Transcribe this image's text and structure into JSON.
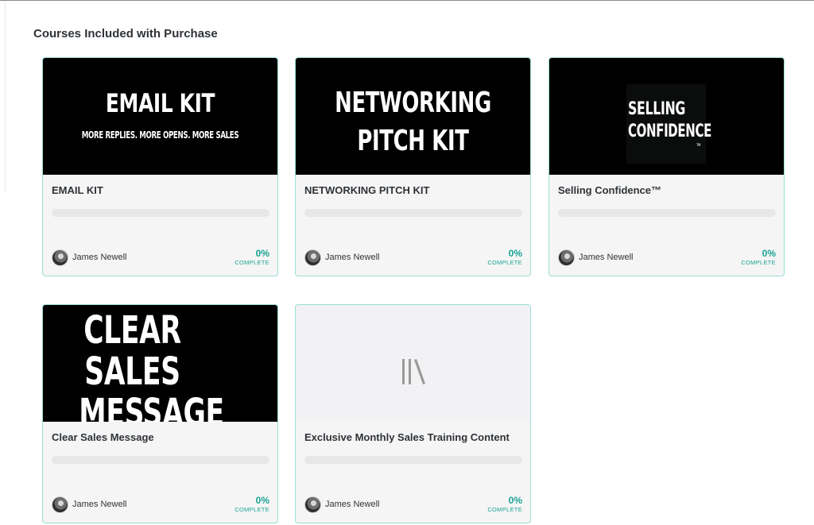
{
  "section": {
    "title": "Courses Included with Purchase"
  },
  "courses": [
    {
      "title": "EMAIL KIT",
      "thumb_lines": [
        "EMAIL KIT",
        "MORE REPLIES. MORE OPENS. MORE SALES"
      ],
      "author": "James Newell",
      "progress_percent": 0,
      "progress_text": "0%",
      "progress_label": "COMPLETE"
    },
    {
      "title": "NETWORKING PITCH KIT",
      "thumb_lines": [
        "NETWORKING",
        "PITCH KIT"
      ],
      "author": "James Newell",
      "progress_percent": 0,
      "progress_text": "0%",
      "progress_label": "COMPLETE"
    },
    {
      "title": "Selling Confidence™",
      "thumb_lines": [
        "SELLING",
        "CONFIDENCE",
        "TM"
      ],
      "author": "James Newell",
      "progress_percent": 0,
      "progress_text": "0%",
      "progress_label": "COMPLETE"
    },
    {
      "title": "Clear Sales Message",
      "thumb_lines": [
        "CLEAR",
        "SALES",
        "MESSAGE"
      ],
      "author": "James Newell",
      "progress_percent": 0,
      "progress_text": "0%",
      "progress_label": "COMPLETE"
    },
    {
      "title": "Exclusive Monthly Sales Training Content",
      "thumb_icon": "books-placeholder-icon",
      "author": "James Newell",
      "progress_percent": 0,
      "progress_text": "0%",
      "progress_label": "COMPLETE"
    }
  ],
  "colors": {
    "accent": "#1aa395",
    "card_border": "#9adfd5",
    "card_bg": "#f5f5f5"
  }
}
